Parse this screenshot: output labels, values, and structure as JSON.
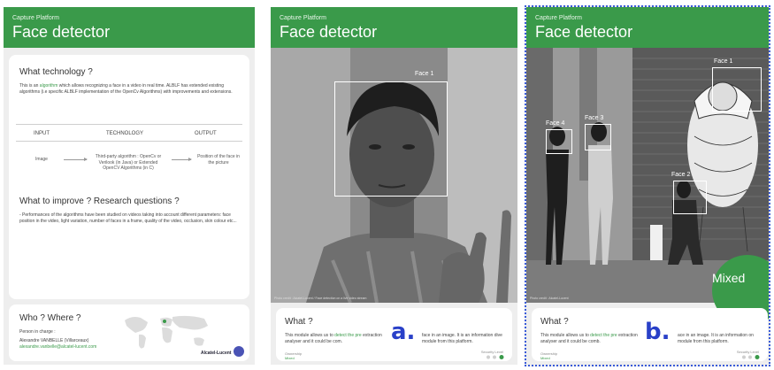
{
  "panel1": {
    "header": {
      "subtitle": "Capture Platform",
      "title": "Face detector"
    },
    "tech_heading": "What technology ?",
    "tech_text_a": "This is an ",
    "tech_text_link": "algorithm",
    "tech_text_b": " which allows recognizing a face in a video in real time. ALBLF has extended existing algorithms (i.e specific ALBLF implementation of the OpenCv Algorithms) with improvements and extensions.",
    "col_input": "INPUT",
    "col_technology": "TECHNOLOGY",
    "col_output": "OUTPUT",
    "row_input": "Image",
    "row_technology": "Third-party algorithm : OpenCv or Verilook (in Java) or Extended OpenCV Algorithms (in C)",
    "row_output": "Position of the face in the picture",
    "improve_heading": "What to improve ? Research questions ?",
    "improve_text": "- Performances of the algorithms have been studied on videos taking into account different parameters: face position in the video, light variation, number of faces in a frame, quality of the video, occlusion, skin colour etc...",
    "who_heading": "Who ? Where ?",
    "person_label": "Person in charge :",
    "person_name": "Alexandre VANBELLE (Villarceaux)",
    "person_email": "alexandre.vanbelle@alcatel-lucent.com",
    "logo_text": "Alcatel-Lucent"
  },
  "panel2": {
    "header": {
      "subtitle": "Capture Platform",
      "title": "Face detector"
    },
    "face_label": "Face 1",
    "credit": "Photo credit : Alcatel-Lucent / Face detection on a live video stream",
    "what_heading": "What ?",
    "what_text_a": "This module allows us to ",
    "what_text_link": "detect the pre",
    "what_text_b": " extraction analyser and it could be com.",
    "what_text_right": "face in an image. It is an information dive module from this platform.",
    "letter": "a.",
    "category_label": "Ownership",
    "category_value": "Mixed",
    "security_label": "Security Level"
  },
  "panel3": {
    "header": {
      "subtitle": "Capture Platform",
      "title": "Face detector"
    },
    "face_labels": [
      "Face 1",
      "Face 2",
      "Face 3",
      "Face 4"
    ],
    "mixed_label": "Mixed",
    "credit": "Photo credit : Alcatel-Lucent",
    "what_heading": "What ?",
    "what_text_a": "This module allows us to ",
    "what_text_link": "detect the pre",
    "what_text_b": " extraction analyser and it could be comb.",
    "what_text_right": "ace in an image. It is an information on module from this platform.",
    "letter": "b.",
    "category_label": "Ownership",
    "category_value": "Mixed",
    "security_label": "Security Level"
  },
  "colors": {
    "header_green": "#3a9a4a",
    "accent_blue": "#2940c8",
    "selection_border": "#3a5bd9"
  }
}
